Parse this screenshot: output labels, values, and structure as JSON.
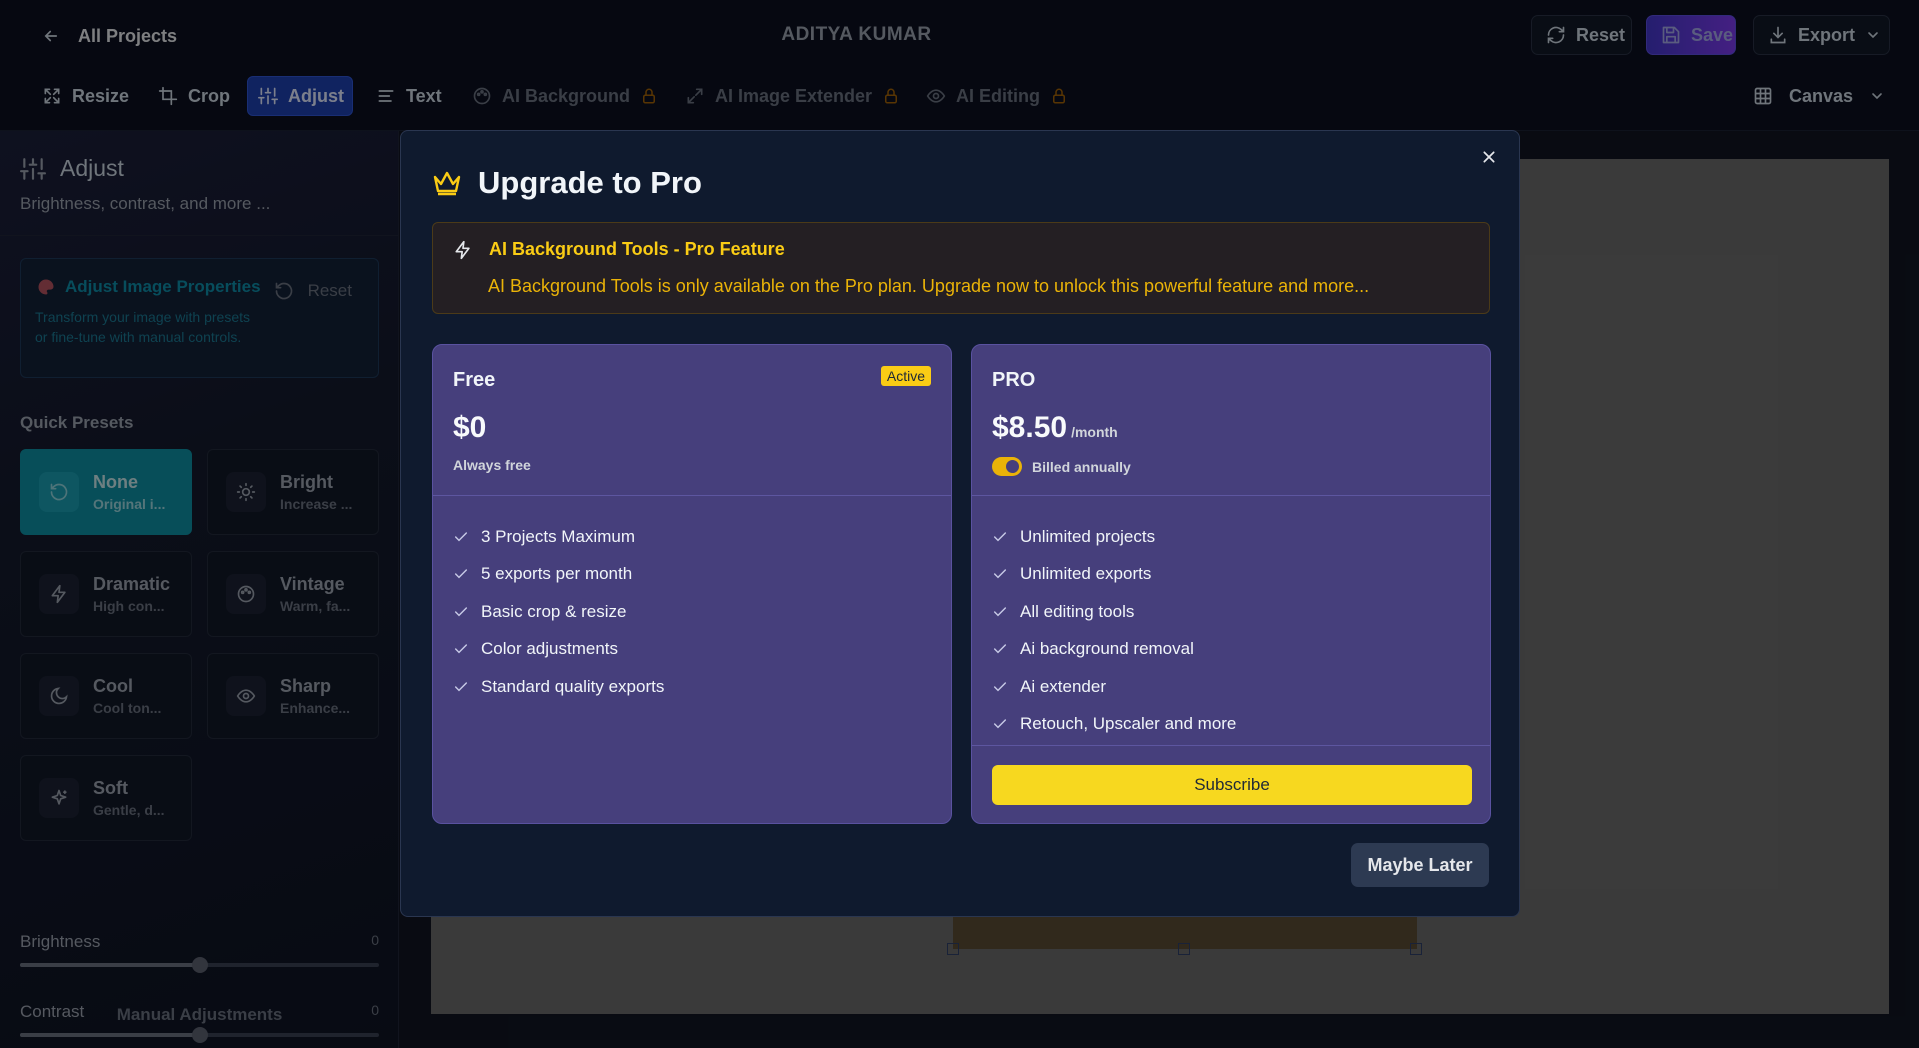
{
  "header": {
    "back_label": "All Projects",
    "title": "ADITYA KUMAR",
    "reset_label": "Reset",
    "save_label": "Save",
    "export_label": "Export"
  },
  "tools": {
    "resize": "Resize",
    "crop": "Crop",
    "adjust": "Adjust",
    "text": "Text",
    "ai_background": "AI Background",
    "ai_extender": "AI Image Extender",
    "ai_editing": "AI Editing",
    "canvas": "Canvas",
    "active": "Adjust"
  },
  "sidebar": {
    "title": "Adjust",
    "subtitle": "Brightness, contrast, and more ...",
    "props_title": "Adjust Image Properties",
    "props_desc": "Transform your image with presets or fine-tune with manual controls.",
    "props_reset": "Reset",
    "quick_presets_label": "Quick Presets",
    "presets": [
      {
        "name": "None",
        "desc": "Original i...",
        "icon": "rotate-ccw-icon",
        "active": true
      },
      {
        "name": "Bright",
        "desc": "Increase ...",
        "icon": "sun-icon"
      },
      {
        "name": "Dramatic",
        "desc": "High con...",
        "icon": "zap-icon"
      },
      {
        "name": "Vintage",
        "desc": "Warm, fa...",
        "icon": "palette-icon"
      },
      {
        "name": "Cool",
        "desc": "Cool ton...",
        "icon": "moon-icon"
      },
      {
        "name": "Sharp",
        "desc": "Enhance...",
        "icon": "eye-icon"
      },
      {
        "name": "Soft",
        "desc": "Gentle, d...",
        "icon": "sparkles-icon"
      }
    ],
    "manual_label": "Manual Adjustments",
    "sliders": [
      {
        "label": "Brightness",
        "value": "0",
        "fraction": 0.5
      },
      {
        "label": "Contrast",
        "value": "0",
        "fraction": 0.5
      }
    ]
  },
  "modal": {
    "title": "Upgrade to Pro",
    "notice_title": "AI Background Tools - Pro Feature",
    "notice_body": "AI Background Tools is only available on the Pro plan. Upgrade now to unlock this powerful feature and more...",
    "free": {
      "name": "Free",
      "badge": "Active",
      "price": "$0",
      "note": "Always free",
      "features": [
        "3 Projects Maximum",
        "5 exports per month",
        "Basic crop & resize",
        "Color adjustments",
        "Standard quality exports"
      ]
    },
    "pro": {
      "name": "PRO",
      "price": "$8.50",
      "per": "/month",
      "note": "Billed annually",
      "billed_annually_on": true,
      "features": [
        "Unlimited projects",
        "Unlimited exports",
        "All editing tools",
        "Ai background removal",
        "Ai extender",
        "Retouch, Upscaler and more"
      ],
      "subscribe": "Subscribe"
    },
    "later": "Maybe Later",
    "close": "×"
  },
  "colors": {
    "accent_teal": "#0e8fa3",
    "pro_yellow": "#f7d81f",
    "plan_card": "#463f7c",
    "active_tool": "#1e40af"
  }
}
